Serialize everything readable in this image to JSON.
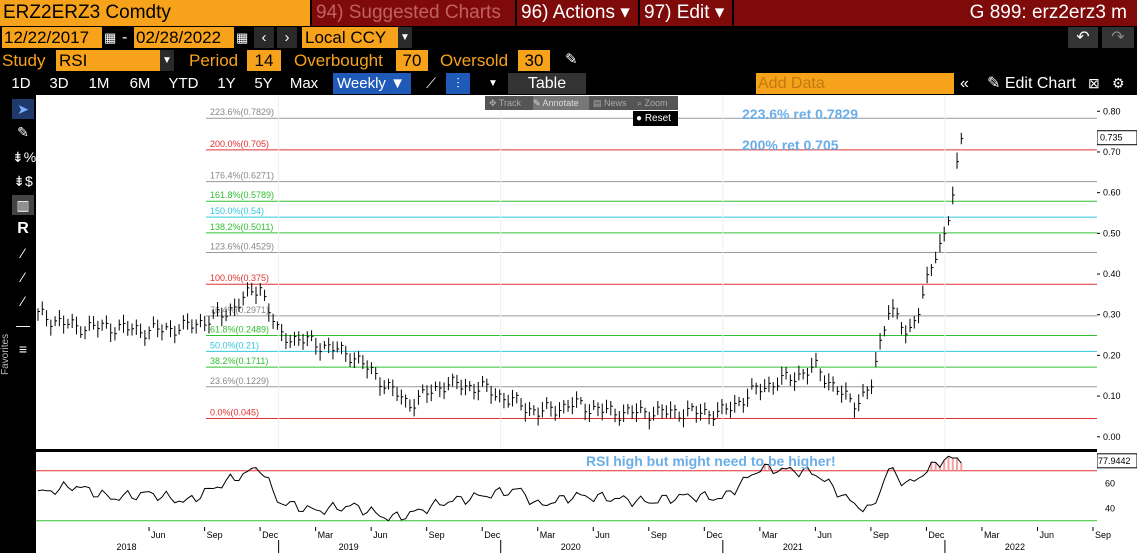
{
  "header": {
    "ticker": "ERZ2ERZ3 Comdty",
    "suggested": "94) Suggested Charts",
    "actions": "96) Actions ▾",
    "edit": "97) Edit ▾",
    "right_title": "G 899: erz2erz3 m"
  },
  "daterange": {
    "start": "12/22/2017",
    "end": "02/28/2022",
    "currency": "Local CCY",
    "sep": "-"
  },
  "study": {
    "label": "Study",
    "name": "RSI",
    "period_label": "Period",
    "period": "14",
    "overbought_label": "Overbought",
    "overbought": "70",
    "oversold_label": "Oversold",
    "oversold": "30"
  },
  "timeframes": [
    "1D",
    "3D",
    "1M",
    "6M",
    "YTD",
    "1Y",
    "5Y",
    "Max"
  ],
  "frequency": "Weekly ▼",
  "table_label": "Table",
  "add_data_placeholder": "Add Data",
  "edit_chart_label": "Edit Chart",
  "favorites_label": "Favorites",
  "float_toolbar": {
    "track": "Track",
    "annotate": "Annotate",
    "news": "News",
    "zoom": "Zoom",
    "reset": "Reset"
  },
  "annotations": {
    "a1": "223.6% ret 0.7829",
    "a2": "200% ret 0.705",
    "rsi_note": "RSI high but might need to be higher!"
  },
  "fib_levels": [
    {
      "label": "223.6%(0.7829)",
      "value": 0.7829,
      "color": "#999999"
    },
    {
      "label": "200.0%(0.705)",
      "value": 0.705,
      "color": "#e03030"
    },
    {
      "label": "176.4%(0.6271)",
      "value": 0.6271,
      "color": "#999999"
    },
    {
      "label": "161.8%(0.5789)",
      "value": 0.5789,
      "color": "#30c030"
    },
    {
      "label": "150.0%(0.54)",
      "value": 0.54,
      "color": "#30c8e0"
    },
    {
      "label": "138.2%(0.5011)",
      "value": 0.5011,
      "color": "#30c030"
    },
    {
      "label": "123.6%(0.4529)",
      "value": 0.4529,
      "color": "#999999"
    },
    {
      "label": "100.0%(0.375)",
      "value": 0.375,
      "color": "#e03030"
    },
    {
      "label": "76.4%(0.2971)",
      "value": 0.2971,
      "color": "#999999"
    },
    {
      "label": "61.8%(0.2489)",
      "value": 0.2489,
      "color": "#30c030"
    },
    {
      "label": "50.0%(0.21)",
      "value": 0.21,
      "color": "#30c8e0"
    },
    {
      "label": "38.2%(0.1711)",
      "value": 0.1711,
      "color": "#30c030"
    },
    {
      "label": "23.6%(0.1229)",
      "value": 0.1229,
      "color": "#999999"
    },
    {
      "label": "0.0%(0.045)",
      "value": 0.045,
      "color": "#e03030"
    }
  ],
  "chart_data": [
    {
      "type": "line",
      "title": "",
      "ylim": [
        -0.03,
        0.84
      ],
      "yticks": [
        "0.80",
        "0.70",
        "0.60",
        "0.50",
        "0.40",
        "0.30",
        "0.20",
        "0.10",
        "0.00"
      ],
      "last_value": "0.735",
      "x": [
        "2017-12",
        "2018-02",
        "2018-04",
        "2018-06",
        "2018-08",
        "2018-10",
        "2018-12",
        "2019-01",
        "2019-03",
        "2019-05",
        "2019-07",
        "2019-08",
        "2019-10",
        "2019-12",
        "2020-02",
        "2020-03",
        "2020-05",
        "2020-07",
        "2020-09",
        "2020-11",
        "2021-01",
        "2021-03",
        "2021-05",
        "2021-06",
        "2021-08",
        "2021-09",
        "2021-10",
        "2021-11",
        "2021-12",
        "2022-01",
        "2022-02"
      ],
      "y": [
        0.3,
        0.27,
        0.27,
        0.26,
        0.27,
        0.3,
        0.37,
        0.25,
        0.23,
        0.2,
        0.12,
        0.08,
        0.13,
        0.12,
        0.08,
        0.06,
        0.08,
        0.06,
        0.06,
        0.06,
        0.06,
        0.12,
        0.15,
        0.17,
        0.08,
        0.12,
        0.33,
        0.24,
        0.38,
        0.5,
        0.75
      ]
    },
    {
      "type": "line",
      "title": "RSI",
      "ylim": [
        25,
        85
      ],
      "yticks": [
        "60",
        "40"
      ],
      "last_value": "77.9442",
      "overbought": 70,
      "oversold": 30,
      "x": [
        "2017-12",
        "2018-02",
        "2018-04",
        "2018-06",
        "2018-08",
        "2018-10",
        "2018-12",
        "2019-01",
        "2019-03",
        "2019-05",
        "2019-07",
        "2019-08",
        "2019-10",
        "2019-12",
        "2020-02",
        "2020-03",
        "2020-05",
        "2020-07",
        "2020-09",
        "2020-11",
        "2021-01",
        "2021-03",
        "2021-05",
        "2021-06",
        "2021-08",
        "2021-09",
        "2021-10",
        "2021-11",
        "2021-12",
        "2022-01",
        "2022-02"
      ],
      "y": [
        52,
        58,
        48,
        52,
        45,
        60,
        73,
        45,
        38,
        42,
        32,
        35,
        45,
        50,
        55,
        42,
        50,
        48,
        45,
        50,
        48,
        72,
        70,
        68,
        44,
        38,
        72,
        58,
        70,
        80,
        78
      ]
    }
  ],
  "x_axis": {
    "months": [
      "Jun",
      "Sep",
      "Dec",
      "Mar",
      "Jun",
      "Sep",
      "Dec",
      "Mar",
      "Jun",
      "Sep",
      "Dec",
      "Mar",
      "Jun",
      "Sep",
      "Dec",
      "Mar",
      "Jun",
      "Sep",
      "Dec",
      "Mar",
      "Jun"
    ],
    "years": [
      "2018",
      "2019",
      "2020",
      "2021",
      "2022"
    ]
  }
}
